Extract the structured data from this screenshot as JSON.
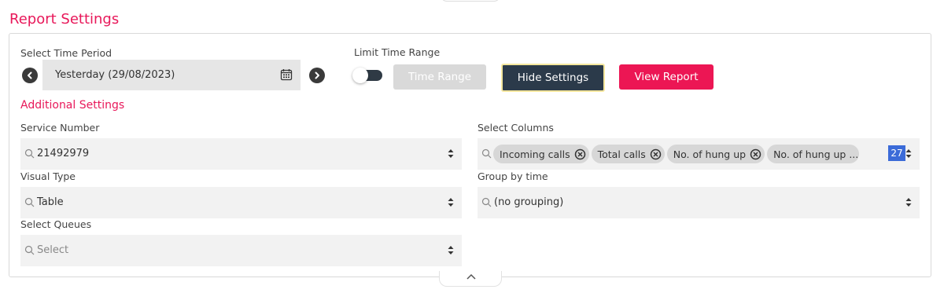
{
  "page": {
    "title": "Report Settings"
  },
  "time_period": {
    "label": "Select Time Period",
    "value": "Yesterday (29/08/2023)"
  },
  "limit_time_range": {
    "label": "Limit Time Range",
    "toggle_on": false,
    "button_label": "Time Range"
  },
  "actions": {
    "hide_settings": "Hide Settings",
    "view_report": "View Report"
  },
  "additional": {
    "title": "Additional Settings",
    "service_number": {
      "label": "Service Number",
      "value": "21492979"
    },
    "select_columns": {
      "label": "Select Columns",
      "chips": [
        "Incoming calls",
        "Total calls",
        "No. of hung up",
        "No. of hung up ..."
      ],
      "count": "27"
    },
    "visual_type": {
      "label": "Visual Type",
      "value": "Table"
    },
    "group_by_time": {
      "label": "Group by time",
      "value": "(no grouping)"
    },
    "select_queues": {
      "label": "Select Queues",
      "placeholder": "Select"
    }
  },
  "colors": {
    "accent": "#e8185a",
    "primary_button": "#ec1654",
    "dark_button": "#2b3a4a",
    "badge": "#3b6bd8"
  }
}
